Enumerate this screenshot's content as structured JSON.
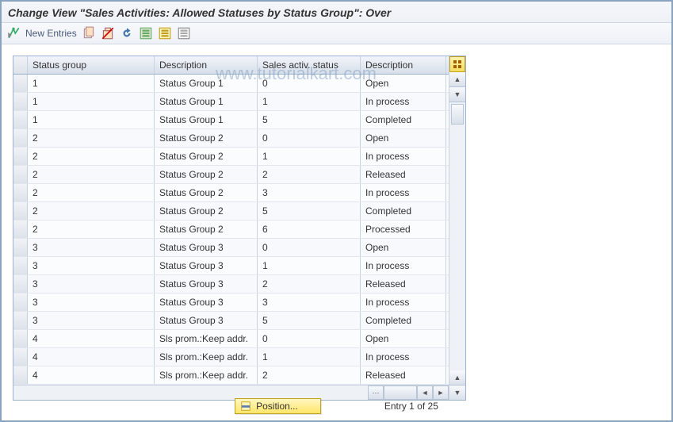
{
  "title": "Change View \"Sales Activities: Allowed Statuses by Status Group\": Over",
  "toolbar": {
    "new_entries": "New Entries"
  },
  "watermark": "www.tutorialkart.com",
  "columns": {
    "sg": "Status group",
    "desc": "Description",
    "sas": "Sales activ. status",
    "desc2": "Description"
  },
  "rows": [
    {
      "sg": "1",
      "desc": "Status Group 1",
      "sas": "0",
      "desc2": "Open"
    },
    {
      "sg": "1",
      "desc": "Status Group 1",
      "sas": "1",
      "desc2": "In process"
    },
    {
      "sg": "1",
      "desc": "Status Group 1",
      "sas": "5",
      "desc2": "Completed"
    },
    {
      "sg": "2",
      "desc": "Status Group 2",
      "sas": "0",
      "desc2": "Open"
    },
    {
      "sg": "2",
      "desc": "Status Group 2",
      "sas": "1",
      "desc2": "In process"
    },
    {
      "sg": "2",
      "desc": "Status Group 2",
      "sas": "2",
      "desc2": "Released"
    },
    {
      "sg": "2",
      "desc": "Status Group 2",
      "sas": "3",
      "desc2": "In process"
    },
    {
      "sg": "2",
      "desc": "Status Group 2",
      "sas": "5",
      "desc2": "Completed"
    },
    {
      "sg": "2",
      "desc": "Status Group 2",
      "sas": "6",
      "desc2": "Processed"
    },
    {
      "sg": "3",
      "desc": "Status Group 3",
      "sas": "0",
      "desc2": "Open"
    },
    {
      "sg": "3",
      "desc": "Status Group 3",
      "sas": "1",
      "desc2": "In process"
    },
    {
      "sg": "3",
      "desc": "Status Group 3",
      "sas": "2",
      "desc2": "Released"
    },
    {
      "sg": "3",
      "desc": "Status Group 3",
      "sas": "3",
      "desc2": "In process"
    },
    {
      "sg": "3",
      "desc": "Status Group 3",
      "sas": "5",
      "desc2": "Completed"
    },
    {
      "sg": "4",
      "desc": "Sls prom.:Keep addr.",
      "sas": "0",
      "desc2": "Open"
    },
    {
      "sg": "4",
      "desc": "Sls prom.:Keep addr.",
      "sas": "1",
      "desc2": "In process"
    },
    {
      "sg": "4",
      "desc": "Sls prom.:Keep addr.",
      "sas": "2",
      "desc2": "Released"
    }
  ],
  "position_button": "Position...",
  "entry_count": "Entry 1 of 25"
}
